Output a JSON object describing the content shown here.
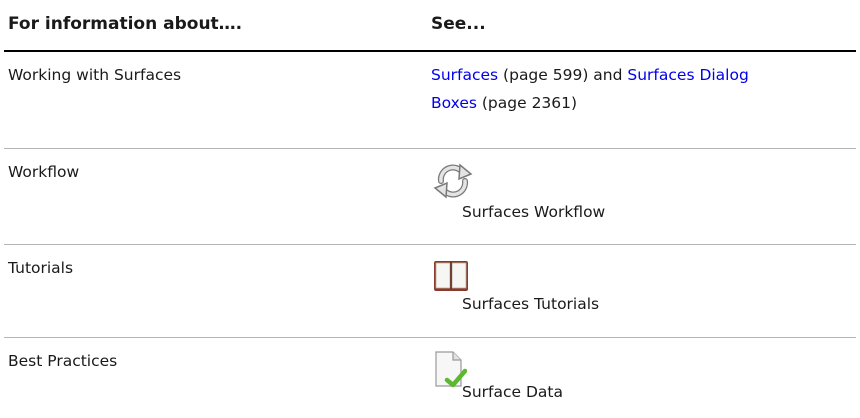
{
  "header": {
    "col1": "For information about….",
    "col2": "See..."
  },
  "rows": [
    {
      "topic": "Working with Surfaces",
      "link1": "Surfaces",
      "ref1": " (page 599) and ",
      "link2_line1": "Surfaces Dialog",
      "link2_line2": "Boxes",
      "ref2": " (page 2361)"
    },
    {
      "topic": "Workflow",
      "icon": "workflow-cycle-icon",
      "label": "Surfaces Workflow"
    },
    {
      "topic": "Tutorials",
      "icon": "book-icon",
      "label": "Surfaces Tutorials"
    },
    {
      "topic": "Best Practices",
      "icon": "document-checkmark-icon",
      "label": "Surface Data"
    }
  ],
  "colors": {
    "link": "#0000ee",
    "rule": "#b5b5b5",
    "check": "#5cb82e"
  }
}
